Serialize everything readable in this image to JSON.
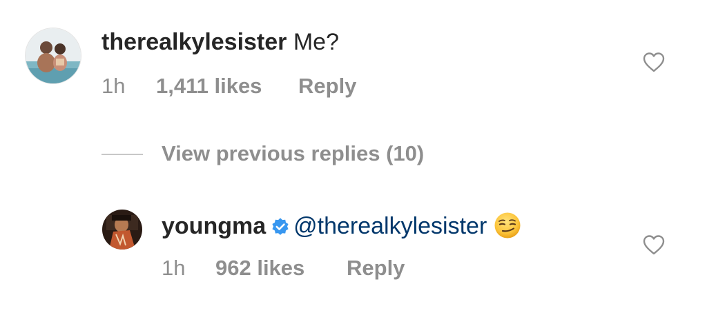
{
  "comment": {
    "username": "therealkylesister",
    "text": "Me?",
    "time": "1h",
    "likes": "1,411 likes",
    "reply_label": "Reply"
  },
  "thread": {
    "view_previous_label": "View previous replies (10)"
  },
  "reply": {
    "username": "youngma",
    "verified": true,
    "mention": "@therealkylesister",
    "emoji": "smirking-face-emoji",
    "time": "1h",
    "likes": "962 likes",
    "reply_label": "Reply"
  },
  "colors": {
    "text": "#262626",
    "muted": "#8e8e8e",
    "mention": "#00376b",
    "verified": "#3897f0"
  }
}
